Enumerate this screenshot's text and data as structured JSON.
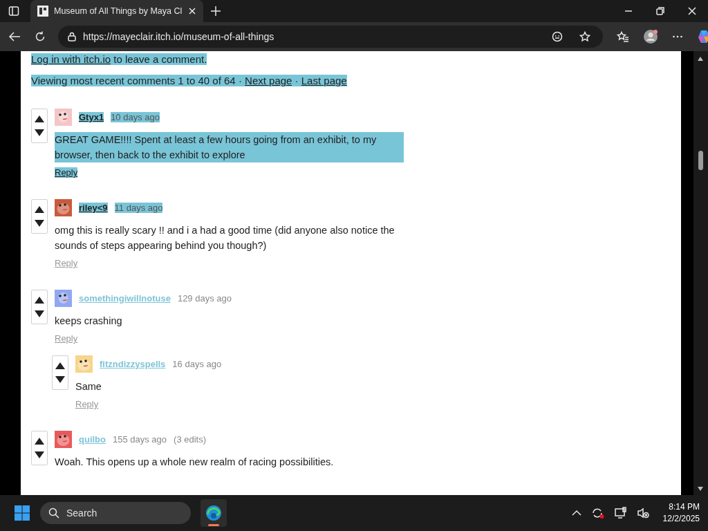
{
  "browser": {
    "tabs": [
      {
        "title": "Museum of All Things by Maya Cl",
        "selected": true
      }
    ],
    "url": "https://mayeclair.itch.io/museum-of-all-things"
  },
  "page": {
    "login_note": {
      "link": "Log in with itch.io",
      "text": "to leave a comment.",
      "highlighted": true
    },
    "pagination": {
      "text": "Viewing most recent comments 1 to 40 of 64 ·",
      "next": "Next page",
      "separator": "·",
      "last": "Last page",
      "highlighted": true
    },
    "comments": [
      {
        "author": "Gtyx1",
        "time": "10 days ago",
        "header_highlighted": true,
        "body": "GREAT GAME!!!! Spent at least a few hours going from an exhibit, to my browser, then back to the exhibit to explore",
        "body_highlighted": true,
        "reply": "Reply",
        "reply_highlighted": true
      },
      {
        "author": "riley<9",
        "time": "11 days ago",
        "header_highlighted": true,
        "body": "omg this is really scary !! and i a had a good time (did anyone also notice the sounds of steps appearing behind you though?)",
        "body_highlighted": false,
        "reply": "Reply",
        "reply_highlighted": false
      },
      {
        "author": "somethingiwillnotuse",
        "time": "129 days ago",
        "header_highlighted": false,
        "body": "keeps crashing",
        "body_highlighted": false,
        "reply": "Reply",
        "reply_highlighted": false,
        "children": [
          {
            "author": "fitzndizzyspells",
            "time": "16 days ago",
            "header_highlighted": false,
            "body": "Same",
            "body_highlighted": false,
            "reply": "Reply",
            "reply_highlighted": false
          }
        ]
      },
      {
        "author": "quilbo",
        "time": "155 days ago",
        "edits": "(3 edits)",
        "header_highlighted": false,
        "body": "Woah. This opens up a whole new realm of racing possibilities.",
        "body_highlighted": false
      }
    ]
  },
  "taskbar": {
    "search_placeholder": "Search",
    "time": "8:14 PM",
    "date": "12/2/2025"
  }
}
